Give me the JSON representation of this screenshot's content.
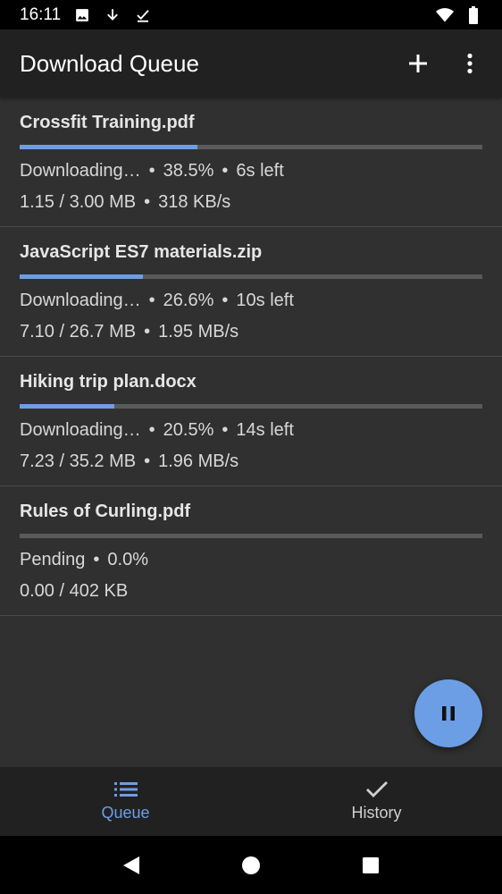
{
  "status_bar": {
    "time": "16:11",
    "left_icons": [
      "image-icon",
      "download-arrow-icon",
      "download-done-icon"
    ],
    "right_icons": [
      "wifi-icon",
      "battery-icon"
    ]
  },
  "app_bar": {
    "title": "Download Queue",
    "actions": [
      "add-icon",
      "more-vert-icon"
    ]
  },
  "colors": {
    "accent": "#6c9ee6",
    "background": "#303030",
    "app_bar": "#212121",
    "track": "#5a5a5a"
  },
  "downloads": [
    {
      "name": "Crossfit Training.pdf",
      "progress": 0.385,
      "status": "Downloading…",
      "percent": "38.5%",
      "time_left": "6s left",
      "size": "1.15 / 3.00 MB",
      "speed": "318 KB/s"
    },
    {
      "name": "JavaScript ES7 materials.zip",
      "progress": 0.266,
      "status": "Downloading…",
      "percent": "26.6%",
      "time_left": "10s left",
      "size": "7.10 / 26.7 MB",
      "speed": "1.95 MB/s"
    },
    {
      "name": "Hiking trip plan.docx",
      "progress": 0.205,
      "status": "Downloading…",
      "percent": "20.5%",
      "time_left": "14s left",
      "size": "7.23 / 35.2 MB",
      "speed": "1.96 MB/s"
    },
    {
      "name": "Rules of Curling.pdf",
      "progress": 0.0,
      "status": "Pending",
      "percent": "0.0%",
      "time_left": "",
      "size": "0.00 / 402 KB",
      "speed": ""
    }
  ],
  "fab": {
    "icon": "pause-icon"
  },
  "bottom_nav": {
    "items": [
      {
        "label": "Queue",
        "icon": "list-icon",
        "active": true
      },
      {
        "label": "History",
        "icon": "check-icon",
        "active": false
      }
    ]
  },
  "system_nav": [
    "back-icon",
    "home-icon",
    "recents-icon"
  ]
}
